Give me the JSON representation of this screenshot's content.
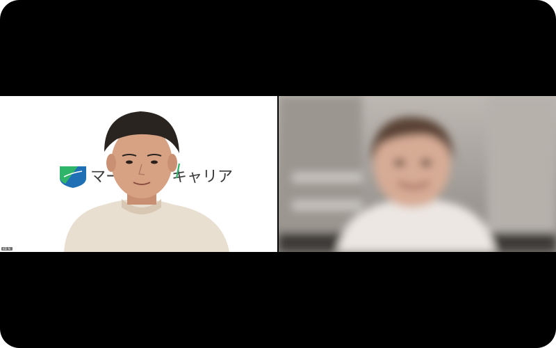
{
  "meeting": {
    "participants": [
      {
        "name_tag": "KEI N.",
        "background_logo": {
          "text_left": "マー",
          "text_right": "キャリア"
        },
        "video": "person-with-virtual-background-icon"
      },
      {
        "name_tag": "",
        "video": "blurred-person-icon"
      }
    ]
  },
  "colors": {
    "window_bg": "#000000",
    "logo_green": "#2fb56a",
    "logo_blue": "#1f6fb5",
    "logo_text": "#3a3a3a",
    "shirt": "#e8dccb",
    "hair": "#2a2420",
    "skin": "#d9a585"
  }
}
